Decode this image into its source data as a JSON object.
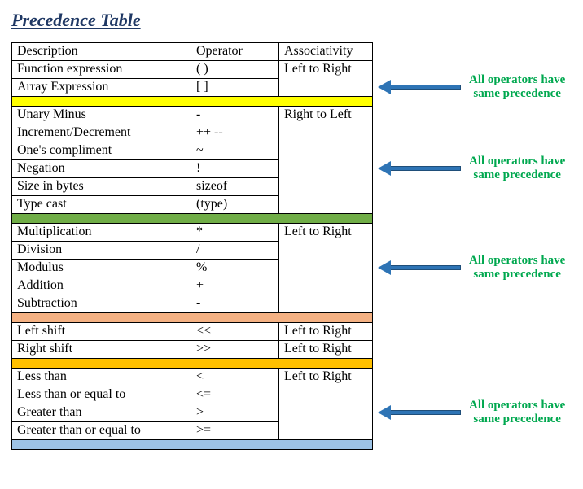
{
  "title": "Precedence Table",
  "headers": {
    "description": "Description",
    "operator": "Operator",
    "associativity": "Associativity"
  },
  "groups": [
    {
      "separator_color": null,
      "associativity": "Left to Right",
      "assoc_repeat": false,
      "rows": [
        {
          "desc": "Function expression",
          "op": "( )"
        },
        {
          "desc": "Array Expression",
          "op": "[ ]"
        }
      ]
    },
    {
      "separator_color": "#ffff00",
      "associativity": "Right to Left",
      "assoc_repeat": false,
      "rows": [
        {
          "desc": "Unary Minus",
          "op": "-"
        },
        {
          "desc": "Increment/Decrement",
          "op": "++ --"
        },
        {
          "desc": "One's compliment",
          "op": "~"
        },
        {
          "desc": "Negation",
          "op": "!"
        },
        {
          "desc": "Size in bytes",
          "op": "sizeof"
        },
        {
          "desc": "Type cast",
          "op": "(type)"
        }
      ]
    },
    {
      "separator_color": "#70ad47",
      "associativity": "Left to Right",
      "assoc_repeat": false,
      "rows": [
        {
          "desc": "Multiplication",
          "op": "*"
        },
        {
          "desc": "Division",
          "op": "/"
        },
        {
          "desc": "Modulus",
          "op": "%"
        },
        {
          "desc": "Addition",
          "op": "+"
        },
        {
          "desc": "Subtraction",
          "op": "-"
        }
      ]
    },
    {
      "separator_color": "#f4b183",
      "associativity": "Left to Right",
      "assoc_repeat": true,
      "rows": [
        {
          "desc": "Left shift",
          "op": "<<"
        },
        {
          "desc": "Right shift",
          "op": ">>"
        }
      ]
    },
    {
      "separator_color": "#ffc000",
      "associativity": "Left to Right",
      "assoc_repeat": false,
      "rows": [
        {
          "desc": "Less than",
          "op": "<"
        },
        {
          "desc": "Less than or equal to",
          "op": "<="
        },
        {
          "desc": "Greater than",
          "op": ">"
        },
        {
          "desc": "Greater than or equal to",
          "op": ">="
        }
      ]
    },
    {
      "separator_color": "#9dc3e6",
      "rows": []
    }
  ],
  "annotation_text": "All operators have\nsame precedence",
  "chart_data": {
    "type": "table",
    "title": "Precedence Table",
    "columns": [
      "Description",
      "Operator",
      "Associativity"
    ],
    "groups": [
      {
        "associativity": "Left to Right",
        "rows": [
          [
            "Function expression",
            "( )"
          ],
          [
            "Array Expression",
            "[ ]"
          ]
        ]
      },
      {
        "associativity": "Right to Left",
        "rows": [
          [
            "Unary Minus",
            "-"
          ],
          [
            "Increment/Decrement",
            "++ --"
          ],
          [
            "One's compliment",
            "~"
          ],
          [
            "Negation",
            "!"
          ],
          [
            "Size in bytes",
            "sizeof"
          ],
          [
            "Type cast",
            "(type)"
          ]
        ]
      },
      {
        "associativity": "Left to Right",
        "rows": [
          [
            "Multiplication",
            "*"
          ],
          [
            "Division",
            "/"
          ],
          [
            "Modulus",
            "%"
          ],
          [
            "Addition",
            "+"
          ],
          [
            "Subtraction",
            "-"
          ]
        ]
      },
      {
        "associativity": "Left to Right",
        "rows": [
          [
            "Left shift",
            "<<"
          ],
          [
            "Right shift",
            ">>"
          ]
        ]
      },
      {
        "associativity": "Left to Right",
        "rows": [
          [
            "Less than",
            "<"
          ],
          [
            "Less than or equal to",
            "<="
          ],
          [
            "Greater than",
            ">"
          ],
          [
            "Greater than or equal to",
            ">="
          ]
        ]
      }
    ],
    "annotation": "All operators have same precedence (applies to each group)"
  }
}
